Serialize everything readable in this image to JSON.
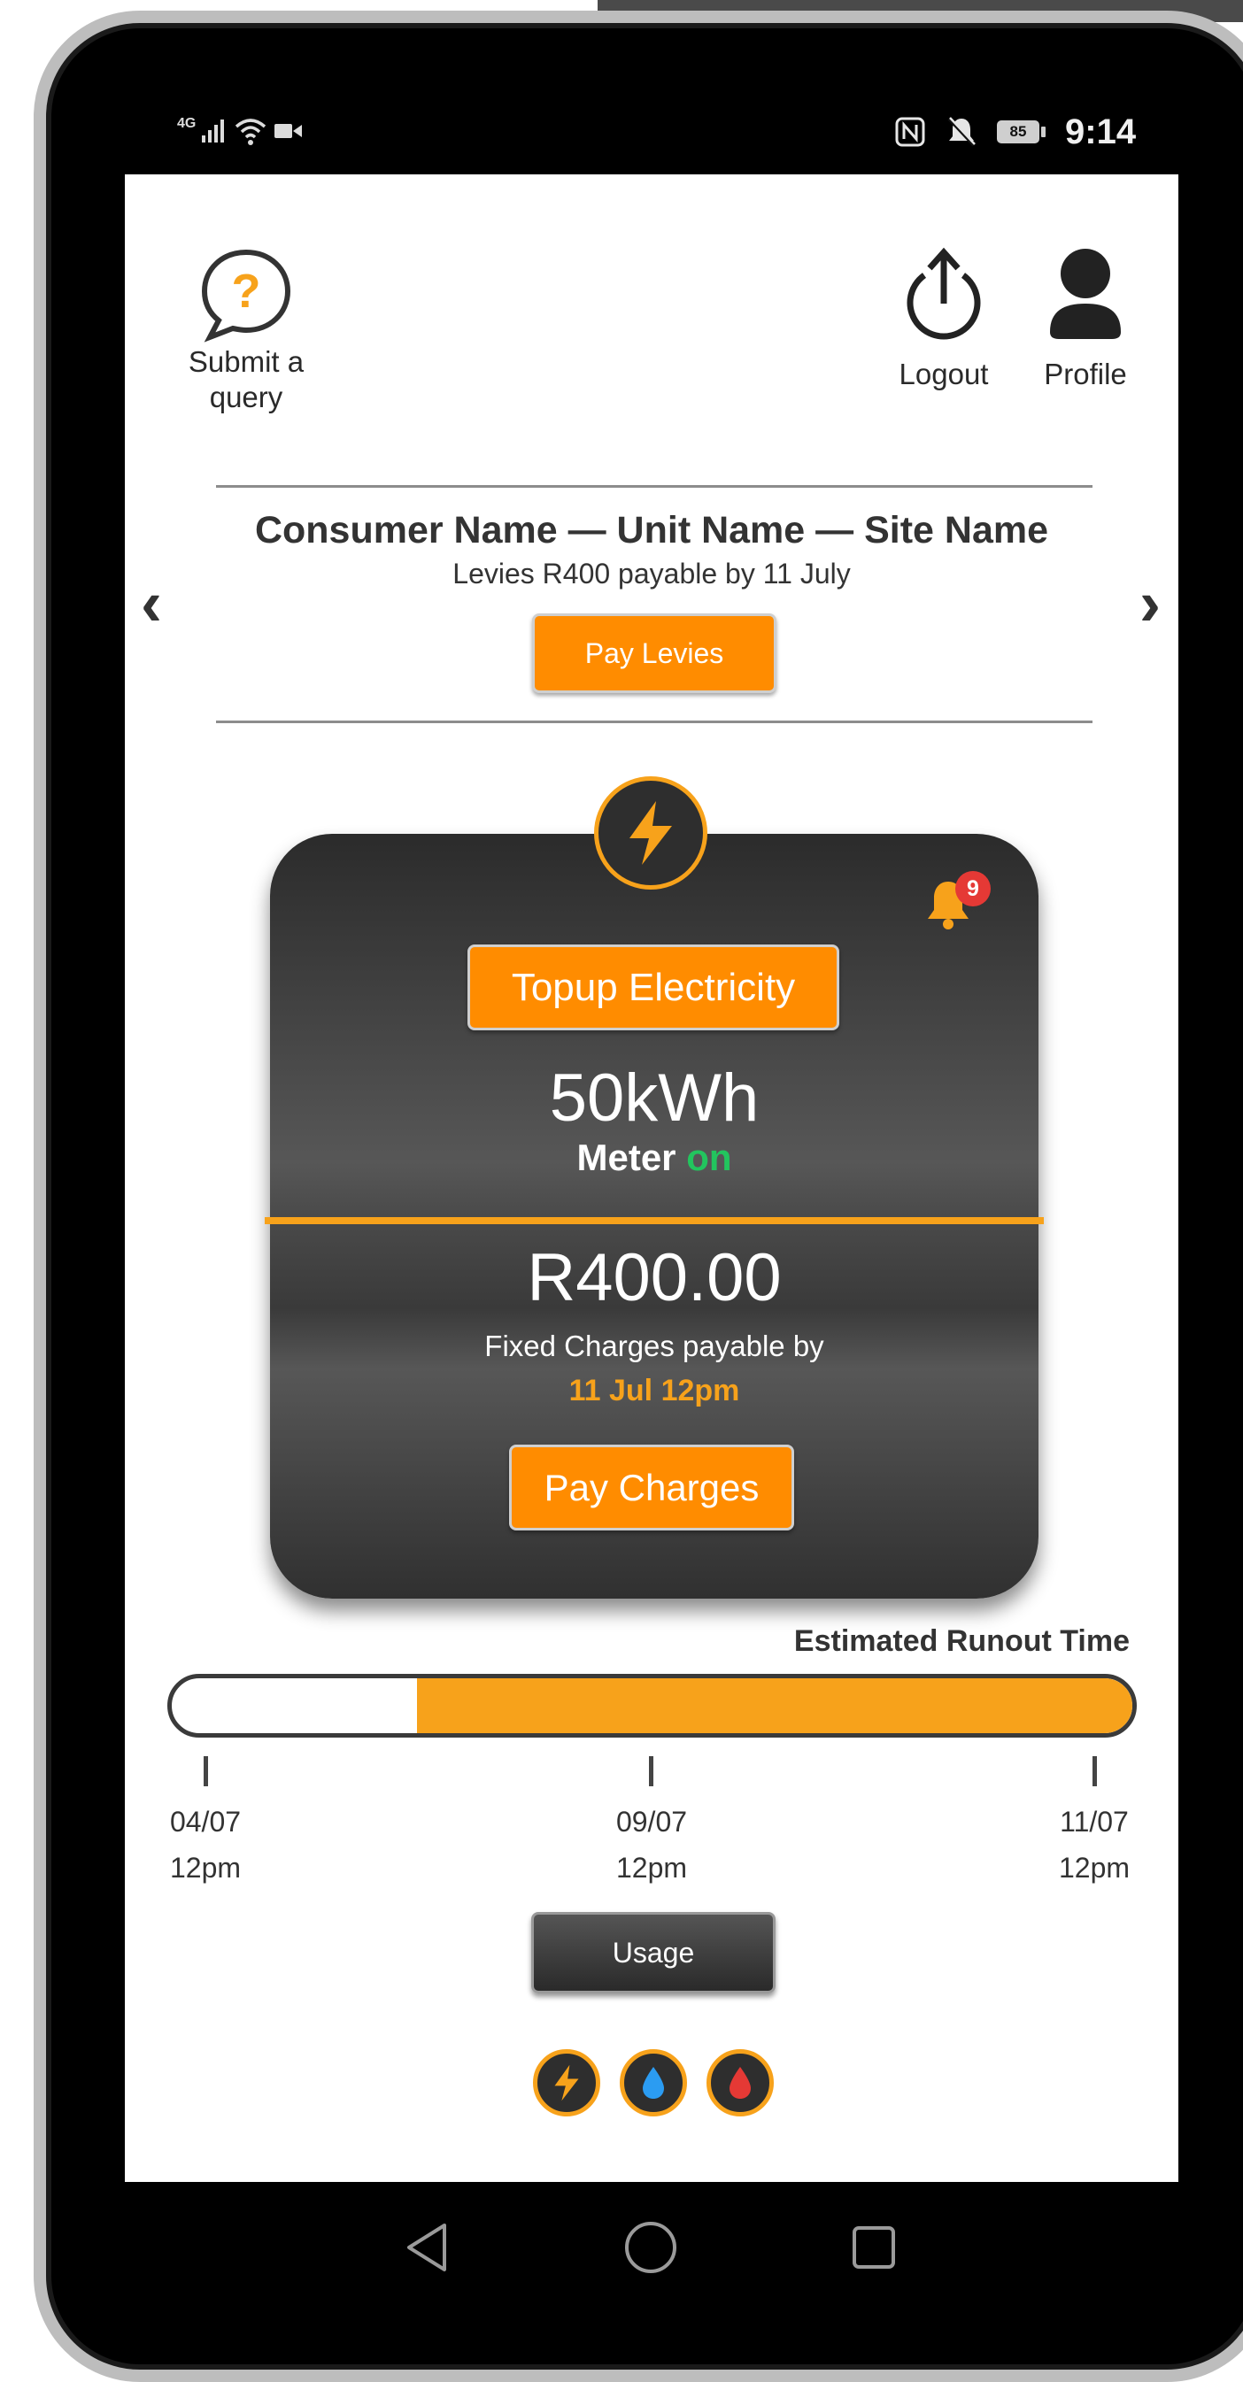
{
  "status_bar": {
    "network": "4G",
    "battery": "85",
    "time": "9:14"
  },
  "header": {
    "query_label": "Submit a query",
    "logout_label": "Logout",
    "profile_label": "Profile"
  },
  "account": {
    "title": "Consumer Name — Unit Name — Site Name",
    "levies_text": "Levies R400 payable by 11 July",
    "pay_levies_label": "Pay Levies",
    "prev_arrow": "‹",
    "next_arrow": "›"
  },
  "card": {
    "notification_count": "9",
    "topup_label": "Topup Electricity",
    "kwh": "50kWh",
    "meter_label": "Meter",
    "meter_state": "on",
    "amount": "R400.00",
    "fixed_text": "Fixed Charges payable by",
    "due": "11 Jul 12pm",
    "pay_charges_label": "Pay Charges"
  },
  "runout": {
    "label": "Estimated Runout Time",
    "progress_used_fraction": 0.255,
    "ticks": [
      {
        "date": "04/07",
        "time": "12pm"
      },
      {
        "date": "09/07",
        "time": "12pm"
      },
      {
        "date": "11/07",
        "time": "12pm"
      }
    ]
  },
  "usage_label": "Usage",
  "utilities": [
    "electricity-icon",
    "water-icon",
    "gas-icon"
  ],
  "colors": {
    "accent": "#f7a21b",
    "button_orange": "#ff8c00",
    "meter_on": "#22c55e",
    "badge_red": "#e53935",
    "water_blue": "#2b9cf2",
    "gas_red": "#e53935"
  }
}
